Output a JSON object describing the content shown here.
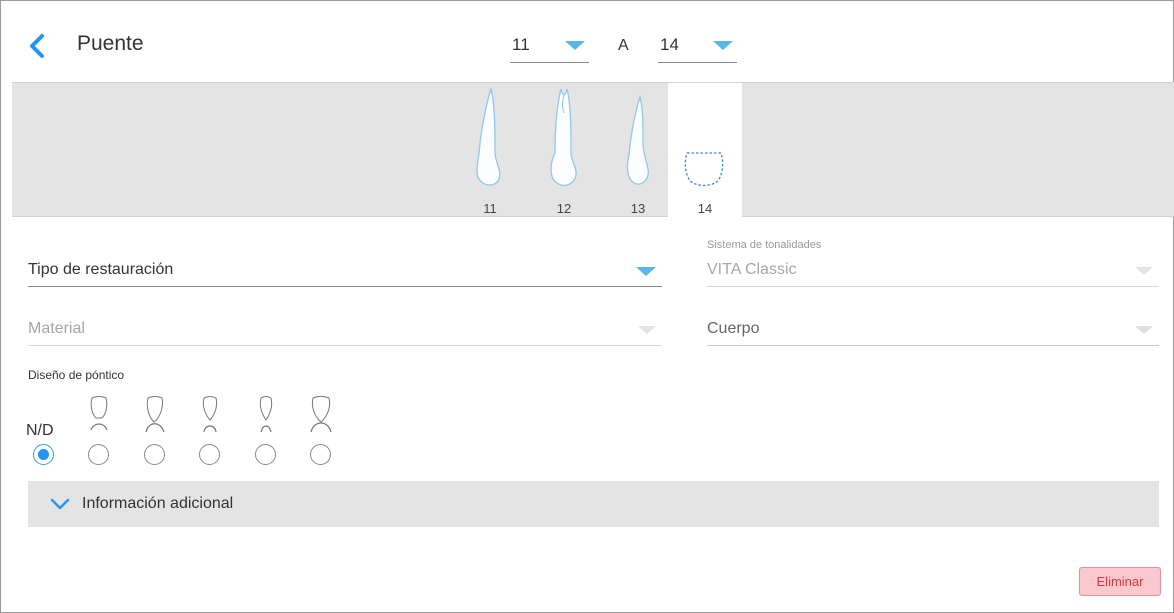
{
  "header": {
    "title": "Puente",
    "from_tooth": "11",
    "to_label": "A",
    "to_tooth": "14"
  },
  "teeth": [
    {
      "number": "11",
      "active": false
    },
    {
      "number": "12",
      "active": false
    },
    {
      "number": "13",
      "active": false
    },
    {
      "number": "14",
      "active": true
    }
  ],
  "form": {
    "restoration_type_label": "Tipo de restauración",
    "shade_system_caption": "Sistema de tonalidades",
    "shade_system_value": "VITA Classic",
    "material_label": "Material",
    "body_label": "Cuerpo",
    "pontic_design_label": "Diseño de póntico",
    "pontic_na_label": "N/D",
    "pontic_selected_index": 0
  },
  "additional_info": {
    "label": "Información adicional"
  },
  "actions": {
    "delete_label": "Eliminar"
  },
  "colors": {
    "accent": "#5bb5e8",
    "radio_selected": "#2196f3",
    "delete_bg": "#f9c9ce",
    "delete_text": "#d9363e"
  }
}
